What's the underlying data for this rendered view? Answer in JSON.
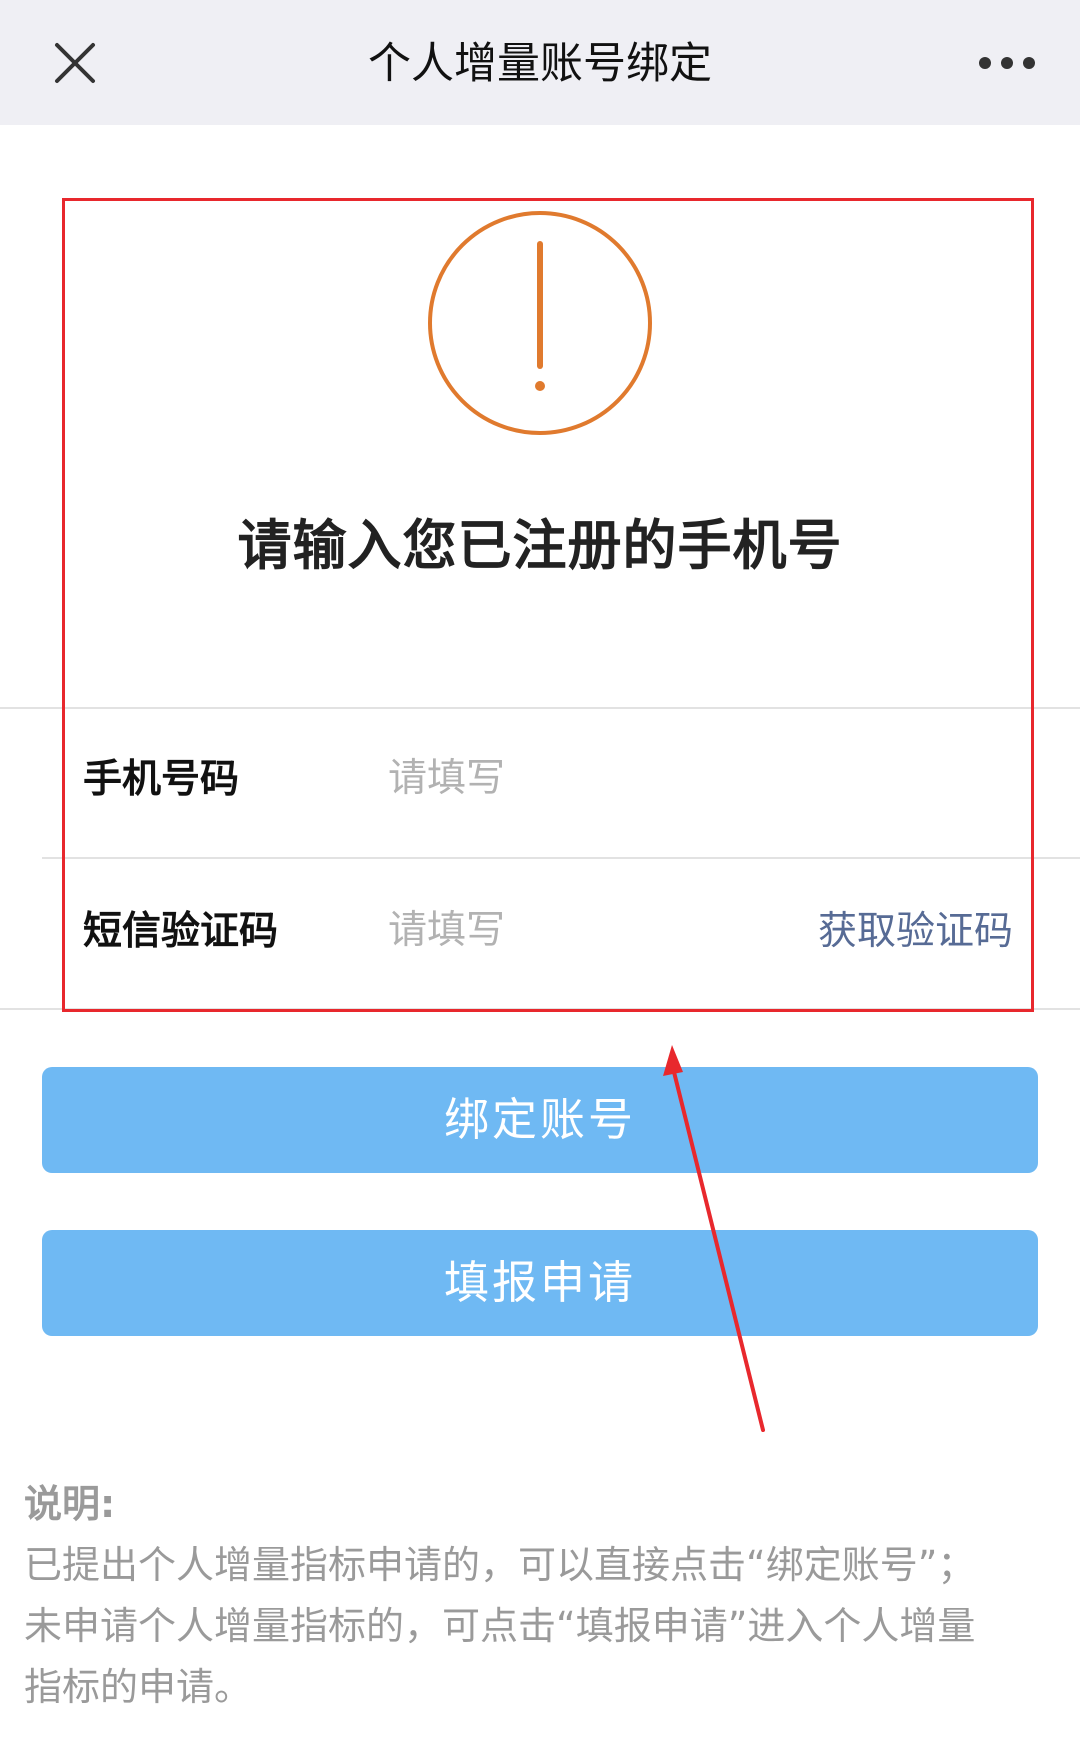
{
  "navbar": {
    "title": "个人增量账号绑定",
    "close_icon": "close-icon",
    "more_icon": "more-dots-icon"
  },
  "alert": {
    "icon": "exclamation-circle-icon",
    "color": "#e07a2e",
    "title": "请输入您已注册的手机号"
  },
  "form": {
    "phone": {
      "label": "手机号码",
      "placeholder": "请填写",
      "value": ""
    },
    "sms_code": {
      "label": "短信验证码",
      "placeholder": "请填写",
      "value": "",
      "get_code_label": "获取验证码"
    }
  },
  "buttons": {
    "bind": "绑定账号",
    "apply": "填报申请",
    "color": "#6fb9f3"
  },
  "notes": {
    "title": "说明:",
    "lines": [
      "已提出个人增量指标申请的，可以直接点击“绑定账号”；",
      "未申请个人增量指标的，可点击“填报申请”进入个人增量",
      "指标的申请。"
    ]
  },
  "annotation": {
    "color": "#e8282d"
  }
}
